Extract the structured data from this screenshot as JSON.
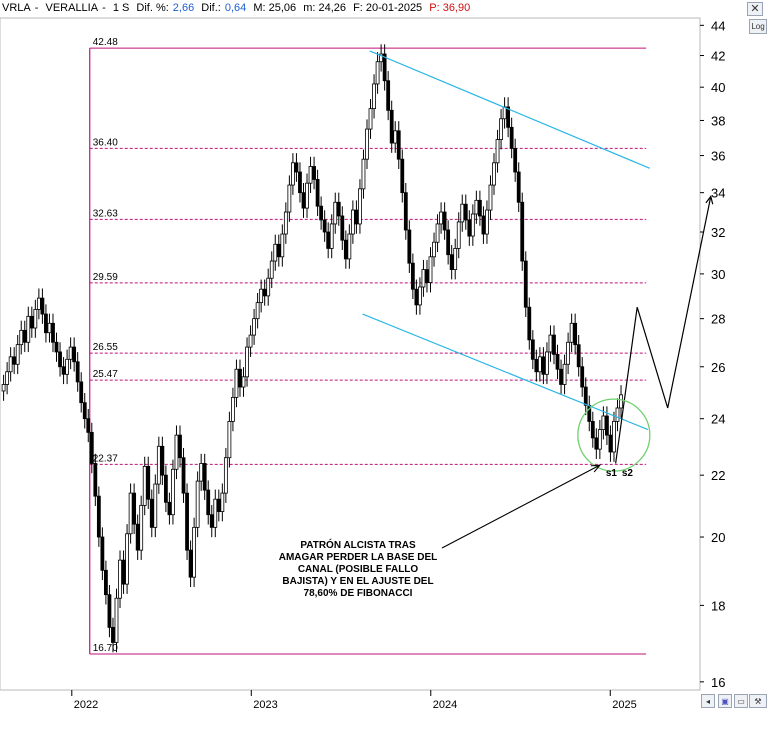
{
  "header": {
    "symbol": "VRLA",
    "sep": "-",
    "name": "VERALLIA",
    "dash": "-",
    "interval": "1 S",
    "dif_pct_label": "Dif. %:",
    "dif_pct_value": "2,66",
    "dif_label": "Dif.:",
    "dif_value": "0,64",
    "max_label": "M: 25,06",
    "min_label": "m: 24,26",
    "date_label": "F: 20-01-2025",
    "price_label": "P: 36,90"
  },
  "toolbar": {
    "close_icon": "close-icon",
    "log_label": "Log",
    "wrench_icon": "wrench-icon"
  },
  "annotation": {
    "lines": [
      "PATRÓN ALCISTA TRAS",
      "AMAGAR PERDER LA BASE DEL",
      "CANAL (POSIBLE FALLO",
      "BAJISTA) Y EN EL AJUSTE DEL",
      "78,60% DE FIBONACCI"
    ],
    "s1": "s1",
    "s2": "s2"
  },
  "colors": {
    "candles": "#000000",
    "fib": "#c0127a",
    "channel": "#29b6e6",
    "circle": "#6fd16f",
    "arrow": "#000000",
    "axis_text": "#000000",
    "header_blue": "#1f5fd0",
    "header_red": "#d01010"
  },
  "chart_data": {
    "type": "line",
    "y_scale": "log",
    "ylim": [
      15.8,
      44.5
    ],
    "yticks": [
      16,
      18,
      20,
      22,
      24,
      26,
      28,
      30,
      32,
      34,
      36,
      38,
      40,
      42,
      44
    ],
    "xticks": [
      {
        "label": "2022",
        "t": 2022.0
      },
      {
        "label": "2023",
        "t": 2023.0
      },
      {
        "label": "2024",
        "t": 2024.0
      },
      {
        "label": "2025",
        "t": 2025.0
      }
    ],
    "xlim": [
      2021.6,
      2025.5
    ],
    "fibonacci": {
      "t_start": 2022.1,
      "t_end": 2025.2,
      "levels": [
        {
          "label": "42.48",
          "value": 42.48
        },
        {
          "label": "36.40",
          "value": 36.4
        },
        {
          "label": "32.63",
          "value": 32.63
        },
        {
          "label": "29.59",
          "value": 29.59
        },
        {
          "label": "26.55",
          "value": 26.55
        },
        {
          "label": "25.47",
          "value": 25.47
        },
        {
          "label": "22.37",
          "value": 22.37
        },
        {
          "label": "16.70",
          "value": 16.7
        }
      ]
    },
    "channel": [
      {
        "t1": 2023.66,
        "v1": 42.3,
        "t2": 2025.22,
        "v2": 35.3
      },
      {
        "t1": 2023.62,
        "v1": 28.2,
        "t2": 2025.21,
        "v2": 23.6
      }
    ],
    "projection": [
      {
        "t": 2025.03,
        "v": 22.4
      },
      {
        "t": 2025.15,
        "v": 28.5
      },
      {
        "t": 2025.32,
        "v": 24.4
      },
      {
        "t": 2025.56,
        "v": 33.8
      }
    ],
    "highlight": {
      "t": 2025.02,
      "v": 23.4
    },
    "weekly_close": [
      25.3,
      25.8,
      26.4,
      26.1,
      26.9,
      27.5,
      27.0,
      28.1,
      27.6,
      28.4,
      28.9,
      28.2,
      27.4,
      27.8,
      27.0,
      26.6,
      26.0,
      25.7,
      26.3,
      26.8,
      26.2,
      25.4,
      24.6,
      24.0,
      23.5,
      22.4,
      21.3,
      20.0,
      19.0,
      18.3,
      17.4,
      17.0,
      18.2,
      19.3,
      18.6,
      20.1,
      21.4,
      20.4,
      19.6,
      21.0,
      22.3,
      21.2,
      20.3,
      21.7,
      23.0,
      22.0,
      21.1,
      20.7,
      22.2,
      23.4,
      22.6,
      21.4,
      19.6,
      18.8,
      20.3,
      21.8,
      22.4,
      21.5,
      20.7,
      20.3,
      21.2,
      20.8,
      21.4,
      22.6,
      23.9,
      24.8,
      25.9,
      25.2,
      25.6,
      26.8,
      27.3,
      28.0,
      28.7,
      29.3,
      29.0,
      29.8,
      30.6,
      31.4,
      30.8,
      31.9,
      33.0,
      34.4,
      35.6,
      35.1,
      34.0,
      33.2,
      34.5,
      35.4,
      34.7,
      33.3,
      32.6,
      32.0,
      31.2,
      32.4,
      33.5,
      32.8,
      31.6,
      30.7,
      31.9,
      33.1,
      32.4,
      34.2,
      35.8,
      37.5,
      38.7,
      40.2,
      41.6,
      42.1,
      40.4,
      38.6,
      36.7,
      37.4,
      35.8,
      34.0,
      32.1,
      30.5,
      29.3,
      28.6,
      29.4,
      30.2,
      29.6,
      30.8,
      31.5,
      32.4,
      33.0,
      32.1,
      30.9,
      30.2,
      31.2,
      32.5,
      33.4,
      32.6,
      31.8,
      32.9,
      33.6,
      32.8,
      31.9,
      33.1,
      34.4,
      35.6,
      36.9,
      38.1,
      38.8,
      37.6,
      36.4,
      35.1,
      33.5,
      30.6,
      28.5,
      27.1,
      26.3,
      25.8,
      26.4,
      25.7,
      26.6,
      27.3,
      26.5,
      25.9,
      25.3,
      26.1,
      27.0,
      27.8,
      26.9,
      26.0,
      25.2,
      24.5,
      23.9,
      23.3,
      22.9,
      23.6,
      24.1,
      23.4,
      22.8,
      23.9,
      24.4,
      24.9
    ]
  }
}
